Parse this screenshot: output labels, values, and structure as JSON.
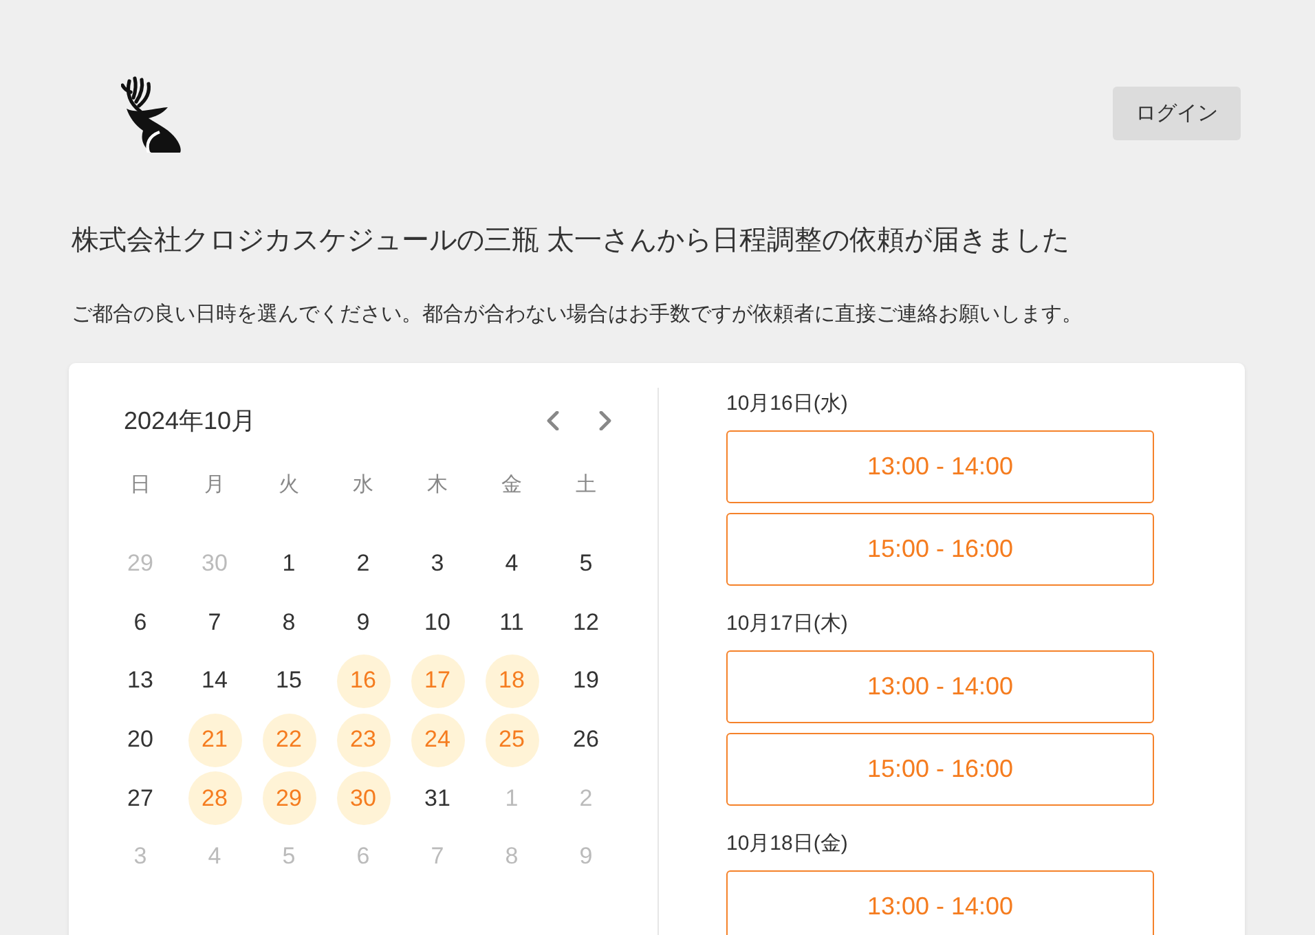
{
  "header": {
    "login_button": "ログイン"
  },
  "title": "株式会社クロジカスケジュールの三瓶 太一さんから日程調整の依頼が届きました",
  "subtitle": "ご都合の良い日時を選んでください。都合が合わない場合はお手数ですが依頼者に直接ご連絡お願いします。",
  "calendar": {
    "month": "2024年10月",
    "weekdays": [
      "日",
      "月",
      "火",
      "水",
      "木",
      "金",
      "土"
    ],
    "days": [
      {
        "label": "29",
        "outside_month": true,
        "available": false
      },
      {
        "label": "30",
        "outside_month": true,
        "available": false
      },
      {
        "label": "1",
        "outside_month": false,
        "available": false
      },
      {
        "label": "2",
        "outside_month": false,
        "available": false
      },
      {
        "label": "3",
        "outside_month": false,
        "available": false
      },
      {
        "label": "4",
        "outside_month": false,
        "available": false
      },
      {
        "label": "5",
        "outside_month": false,
        "available": false
      },
      {
        "label": "6",
        "outside_month": false,
        "available": false
      },
      {
        "label": "7",
        "outside_month": false,
        "available": false
      },
      {
        "label": "8",
        "outside_month": false,
        "available": false
      },
      {
        "label": "9",
        "outside_month": false,
        "available": false
      },
      {
        "label": "10",
        "outside_month": false,
        "available": false
      },
      {
        "label": "11",
        "outside_month": false,
        "available": false
      },
      {
        "label": "12",
        "outside_month": false,
        "available": false
      },
      {
        "label": "13",
        "outside_month": false,
        "available": false
      },
      {
        "label": "14",
        "outside_month": false,
        "available": false
      },
      {
        "label": "15",
        "outside_month": false,
        "available": false
      },
      {
        "label": "16",
        "outside_month": false,
        "available": true
      },
      {
        "label": "17",
        "outside_month": false,
        "available": true
      },
      {
        "label": "18",
        "outside_month": false,
        "available": true
      },
      {
        "label": "19",
        "outside_month": false,
        "available": false
      },
      {
        "label": "20",
        "outside_month": false,
        "available": false
      },
      {
        "label": "21",
        "outside_month": false,
        "available": true
      },
      {
        "label": "22",
        "outside_month": false,
        "available": true
      },
      {
        "label": "23",
        "outside_month": false,
        "available": true
      },
      {
        "label": "24",
        "outside_month": false,
        "available": true
      },
      {
        "label": "25",
        "outside_month": false,
        "available": true
      },
      {
        "label": "26",
        "outside_month": false,
        "available": false
      },
      {
        "label": "27",
        "outside_month": false,
        "available": false
      },
      {
        "label": "28",
        "outside_month": false,
        "available": true
      },
      {
        "label": "29",
        "outside_month": false,
        "available": true
      },
      {
        "label": "30",
        "outside_month": false,
        "available": true
      },
      {
        "label": "31",
        "outside_month": false,
        "available": false
      },
      {
        "label": "1",
        "outside_month": true,
        "available": false
      },
      {
        "label": "2",
        "outside_month": true,
        "available": false
      },
      {
        "label": "3",
        "outside_month": true,
        "available": false
      },
      {
        "label": "4",
        "outside_month": true,
        "available": false
      },
      {
        "label": "5",
        "outside_month": true,
        "available": false
      },
      {
        "label": "6",
        "outside_month": true,
        "available": false
      },
      {
        "label": "7",
        "outside_month": true,
        "available": false
      },
      {
        "label": "8",
        "outside_month": true,
        "available": false
      },
      {
        "label": "9",
        "outside_month": true,
        "available": false
      }
    ]
  },
  "slots": [
    {
      "date": "10月16日(水)",
      "times": [
        "13:00 - 14:00",
        "15:00 - 16:00"
      ]
    },
    {
      "date": "10月17日(木)",
      "times": [
        "13:00 - 14:00",
        "15:00 - 16:00"
      ]
    },
    {
      "date": "10月18日(金)",
      "times": [
        "13:00 - 14:00"
      ]
    }
  ]
}
